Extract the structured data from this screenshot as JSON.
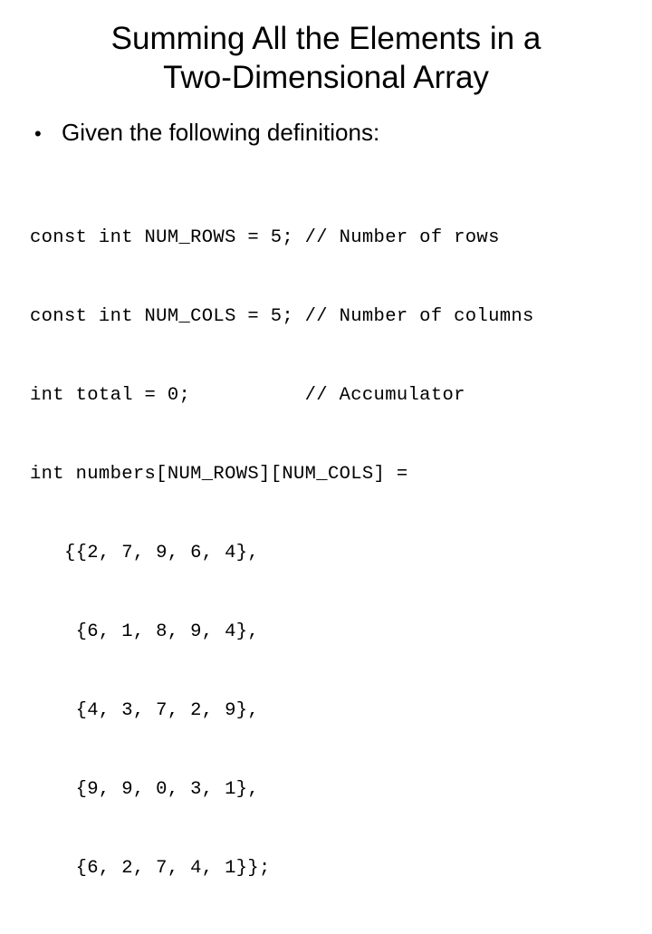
{
  "slide": {
    "background_color": "#ffffff",
    "text_color": "#000000",
    "title": {
      "line1": "Summing All the Elements in a",
      "line2": "Two-Dimensional Array",
      "full": "Summing All the Elements in a Two-Dimensional Array"
    },
    "bullets": [
      {
        "marker": "•",
        "text": "Given the following definitions:"
      }
    ],
    "code": {
      "language": "cpp",
      "lines": [
        "const int NUM_ROWS = 5; // Number of rows",
        "const int NUM_COLS = 5; // Number of columns",
        "int total = 0;          // Accumulator",
        "int numbers[NUM_ROWS][NUM_COLS] =",
        "   {{2, 7, 9, 6, 4},",
        "    {6, 1, 8, 9, 4},",
        "    {4, 3, 7, 2, 9},",
        "    {9, 9, 0, 3, 1},",
        "    {6, 2, 7, 4, 1}};"
      ],
      "declarations": [
        {
          "name": "NUM_ROWS",
          "type": "const int",
          "value": "5",
          "comment": "// Number of rows"
        },
        {
          "name": "NUM_COLS",
          "type": "const int",
          "value": "5",
          "comment": "// Number of columns"
        },
        {
          "name": "total",
          "type": "int",
          "value": "0",
          "comment": "// Accumulator"
        },
        {
          "name": "numbers",
          "type": "int",
          "dimensions": "[NUM_ROWS][NUM_COLS]",
          "value": "",
          "comment": ""
        }
      ],
      "array_values": [
        [
          2,
          7,
          9,
          6,
          4
        ],
        [
          6,
          1,
          8,
          9,
          4
        ],
        [
          4,
          3,
          7,
          2,
          9
        ],
        [
          9,
          9,
          0,
          3,
          1
        ],
        [
          6,
          2,
          7,
          4,
          1
        ]
      ],
      "num_rows": 5,
      "num_cols": 5
    }
  }
}
